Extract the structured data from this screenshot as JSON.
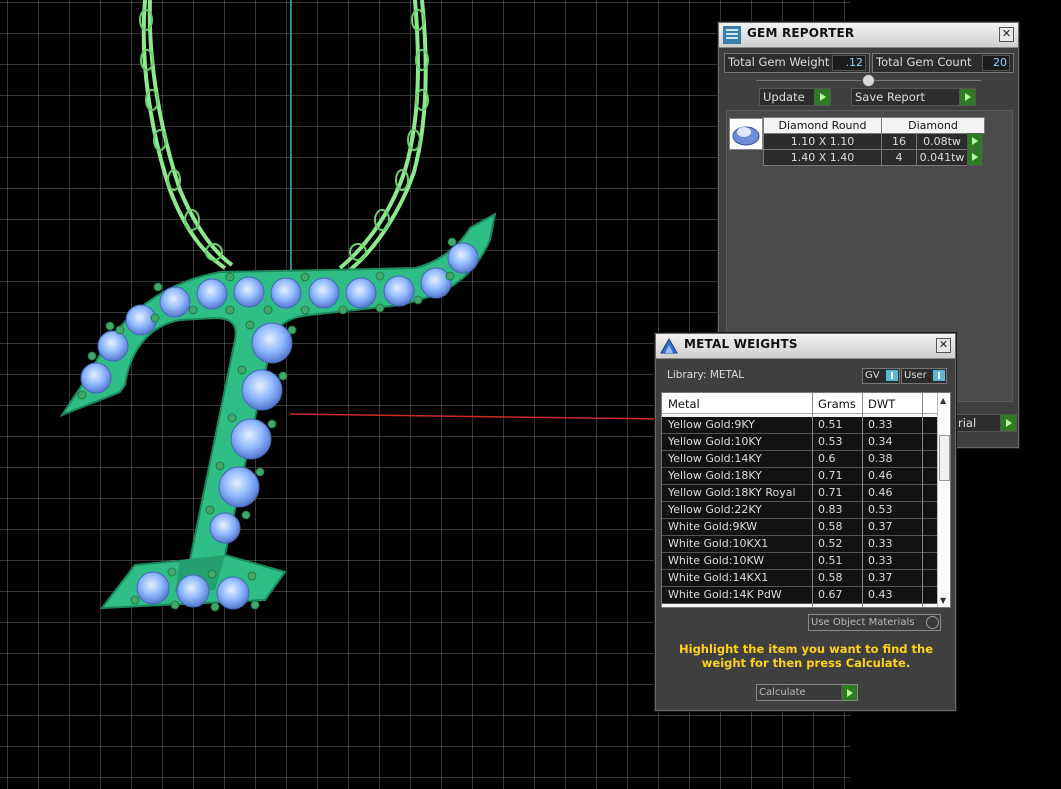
{
  "gem_reporter": {
    "title": "GEM REPORTER",
    "total_weight_label": "Total Gem Weight",
    "total_weight_value": ".12",
    "total_count_label": "Total Gem Count",
    "total_count_value": "20",
    "update_label": "Update",
    "save_report_label": "Save Report",
    "table_header_shape": "Diamond Round",
    "table_header_type": "Diamond",
    "rows": [
      {
        "size": "1.10 X 1.10",
        "count": "16",
        "weight": "0.08tw"
      },
      {
        "size": "1.40 X 1.40",
        "count": "4",
        "weight": "0.041tw"
      }
    ],
    "hidden_button_label": "rial"
  },
  "metal_weights": {
    "title": "METAL WEIGHTS",
    "library_label": "Library: METAL",
    "gv_label": "GV",
    "user_label": "User",
    "columns": [
      "Metal",
      "Grams",
      "DWT"
    ],
    "rows": [
      {
        "metal": "Yellow Gold:9KY",
        "grams": "0.51",
        "dwt": "0.33"
      },
      {
        "metal": "Yellow Gold:10KY",
        "grams": "0.53",
        "dwt": "0.34"
      },
      {
        "metal": "Yellow Gold:14KY",
        "grams": "0.6",
        "dwt": "0.38"
      },
      {
        "metal": "Yellow Gold:18KY",
        "grams": "0.71",
        "dwt": "0.46"
      },
      {
        "metal": "Yellow Gold:18KY Royal",
        "grams": "0.71",
        "dwt": "0.46"
      },
      {
        "metal": "Yellow Gold:22KY",
        "grams": "0.83",
        "dwt": "0.53"
      },
      {
        "metal": "White Gold:9KW",
        "grams": "0.58",
        "dwt": "0.37"
      },
      {
        "metal": "White Gold:10KX1",
        "grams": "0.52",
        "dwt": "0.33"
      },
      {
        "metal": "White Gold:10KW",
        "grams": "0.51",
        "dwt": "0.33"
      },
      {
        "metal": "White Gold:14KX1",
        "grams": "0.58",
        "dwt": "0.37"
      },
      {
        "metal": "White Gold:14K PdW",
        "grams": "0.67",
        "dwt": "0.43"
      }
    ],
    "use_object_materials_label": "Use Object Materials",
    "hint_text": "Highlight the item you want to find the weight for then press Calculate.",
    "calculate_label": "Calculate"
  },
  "colors": {
    "model_green": "#2fbf86",
    "chain_green": "#8ee88e",
    "gem_blue": "#8fb8ff",
    "hint_yellow": "#ffd21a",
    "arrow_green": "#2f7a24"
  }
}
